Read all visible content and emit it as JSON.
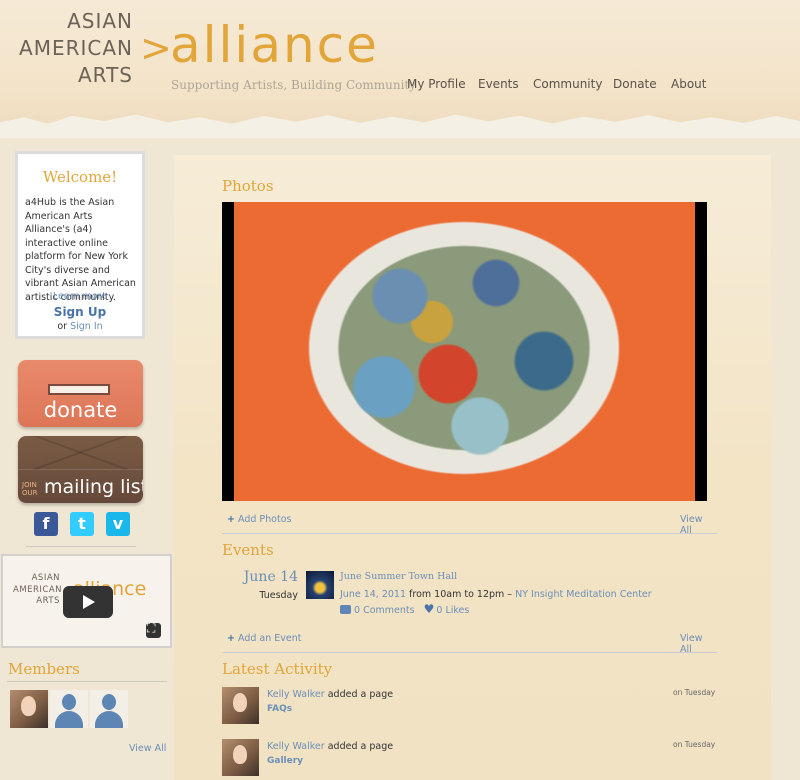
{
  "header": {
    "logo_line1": "ASIAN",
    "logo_line2": "AMERICAN",
    "logo_line3": "ARTS",
    "logo_arrow": ">",
    "logo_big": "alliance",
    "tagline": "Supporting Artists, Building Community",
    "nav": [
      "My Profile",
      "Events",
      "Community",
      "Donate",
      "About"
    ]
  },
  "welcome": {
    "title": "Welcome!",
    "text": "a4Hub is the Asian American Arts Alliance's (a4) interactive online platform for New York City's diverse and vibrant Asian American artistic community.",
    "learn_more": "Learn more",
    "sign_up": "Sign Up",
    "or": "or",
    "sign_in": "Sign In"
  },
  "buttons": {
    "donate": "donate",
    "join": "JOIN OUR",
    "mailing_list": "mailing list"
  },
  "social": [
    {
      "icon": "facebook-icon",
      "glyph": "f",
      "color": "#3b5998"
    },
    {
      "icon": "twitter-icon",
      "glyph": "t",
      "color": "#33ccff"
    },
    {
      "icon": "vimeo-icon",
      "glyph": "v",
      "color": "#1ab7ea"
    }
  ],
  "video": {
    "logo_line1": "ASIAN",
    "logo_line2": "AMERICAN",
    "logo_line3": "ARTS",
    "logo_big": "alliance"
  },
  "members": {
    "title": "Members",
    "view_all": "View All"
  },
  "photos": {
    "title": "Photos",
    "add": "Add Photos",
    "view_all": "View All"
  },
  "events": {
    "title": "Events",
    "date": "June 14",
    "day": "Tuesday",
    "event_title": "June Summer Town Hall",
    "event_date_time": "June 14, 2011",
    "from_text": "from 10am to 12pm –",
    "location": "NY Insight Meditation Center",
    "comments": "0 Comments",
    "likes": "0 Likes",
    "add": "Add an Event",
    "view_all": "View All"
  },
  "activity": {
    "title": "Latest Activity",
    "items": [
      {
        "user": "Kelly Walker",
        "action": "added a page",
        "item": "FAQs",
        "when": "on Tuesday"
      },
      {
        "user": "Kelly Walker",
        "action": "added a page",
        "item": "Gallery",
        "when": "on Tuesday"
      }
    ]
  },
  "colors": {
    "accent": "#e2a53a",
    "link": "#6b8fb8",
    "donate": "#dd7657",
    "mail": "#66483a"
  }
}
